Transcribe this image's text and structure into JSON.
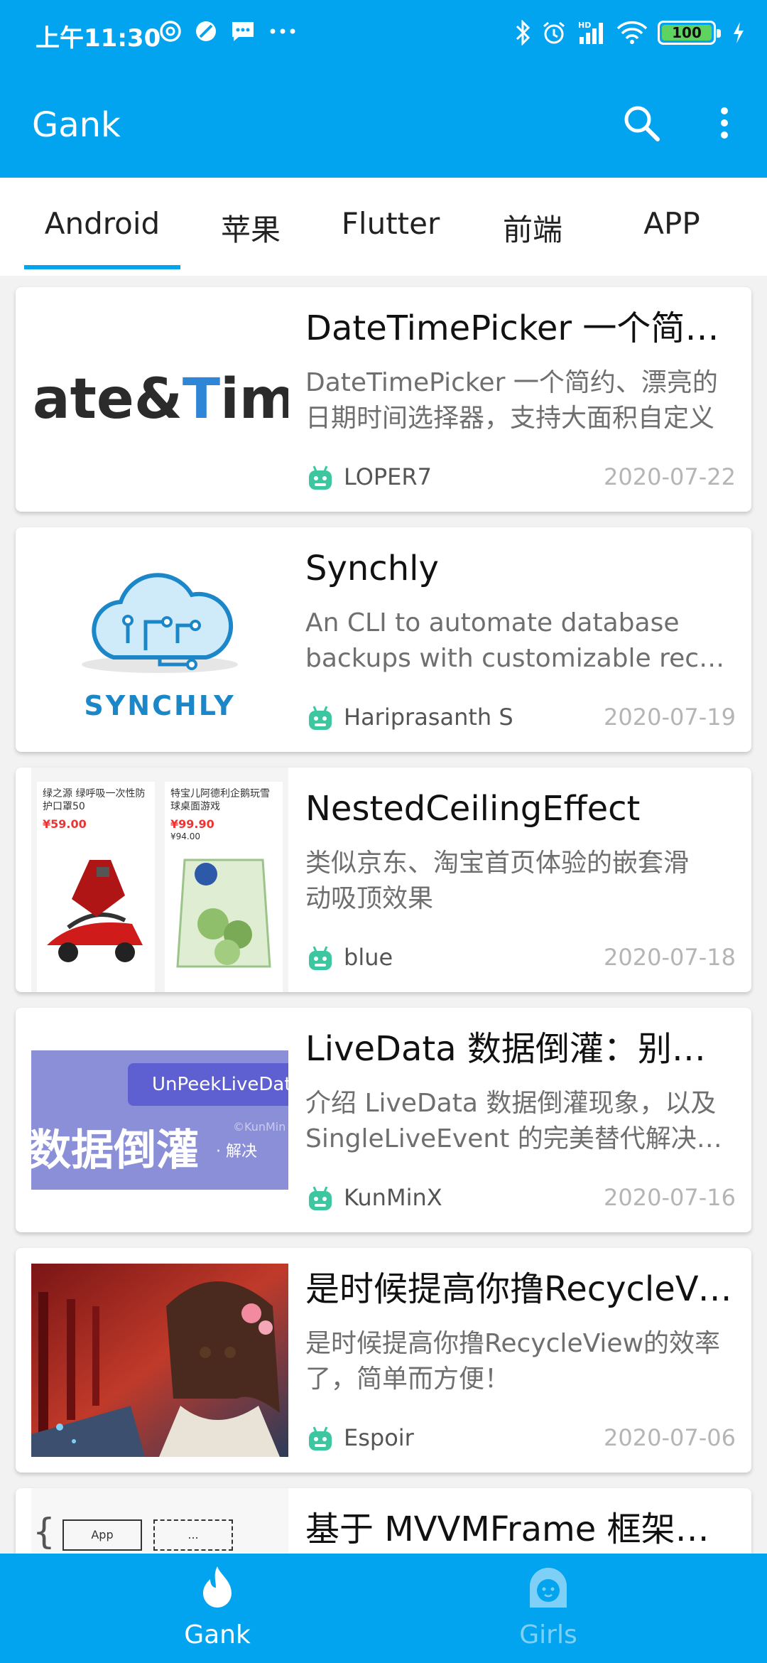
{
  "status_bar": {
    "time": "上午11:30",
    "battery": "100"
  },
  "app_bar": {
    "title": "Gank"
  },
  "tabs": [
    {
      "label": "Android",
      "selected": true
    },
    {
      "label": "苹果",
      "selected": false
    },
    {
      "label": "Flutter",
      "selected": false
    },
    {
      "label": "前端",
      "selected": false
    },
    {
      "label": "APP",
      "selected": false
    }
  ],
  "articles": [
    {
      "title": "DateTimePicker 一个简约、漂亮的日期时间选择器",
      "desc_line1": "DateTimePicker 一个简约、漂亮的",
      "desc_line2": "日期时间选择器，支持大面积自定义",
      "author": "LOPER7",
      "date": "2020-07-22",
      "thumb_text_a": "ate&",
      "thumb_text_b": "T",
      "thumb_text_c": "ime"
    },
    {
      "title": "Synchly",
      "desc_line1": "An CLI to automate database",
      "desc_line2": "backups with customizable recurring schedules",
      "author": "Hariprasanth S",
      "date": "2020-07-19",
      "thumb_text": "SYNCHLY"
    },
    {
      "title": "NestedCeilingEffect",
      "desc_line1": "类似京东、淘宝首页体验的嵌套滑",
      "desc_line2": "动吸顶效果",
      "author": "blue",
      "date": "2020-07-18",
      "thumb_p1_title": "绿之源 绿呼吸一次性防护口罩50",
      "thumb_p1_price": "¥59.00",
      "thumb_p2_title": "特宝儿阿德利企鹅玩雪球桌面游戏",
      "thumb_p2_price": "¥99.90",
      "thumb_p2_old": "¥94.00"
    },
    {
      "title": "LiveData 数据倒灌：别问，问就是不可预期",
      "desc_line1": "介绍 LiveData 数据倒灌现象，以及",
      "desc_line2": "SingleLiveEvent 的完美替代解决方案",
      "author": "KunMinX",
      "date": "2020-07-16",
      "thumb_badge": "UnPeekLiveData",
      "thumb_big": "数据倒灌",
      "thumb_small": "· 解决",
      "thumb_watermark": "©KunMin"
    },
    {
      "title": "是时候提高你撸RecycleView的效率了",
      "desc_line1": "是时候提高你撸RecycleView的效率",
      "desc_line2": "了，简单而方便！",
      "author": "Espoir",
      "date": "2020-07-06"
    },
    {
      "title": "基于 MVVMFrame 框架为例的",
      "thumb_box1": "App",
      "thumb_box2": "..."
    }
  ],
  "bottom_nav": [
    {
      "label": "Gank",
      "selected": true
    },
    {
      "label": "Girls",
      "selected": false
    }
  ],
  "colors": {
    "primary": "#02a4ef",
    "indicator": "#02a4ef",
    "author_icon": "#3cc7a0"
  }
}
